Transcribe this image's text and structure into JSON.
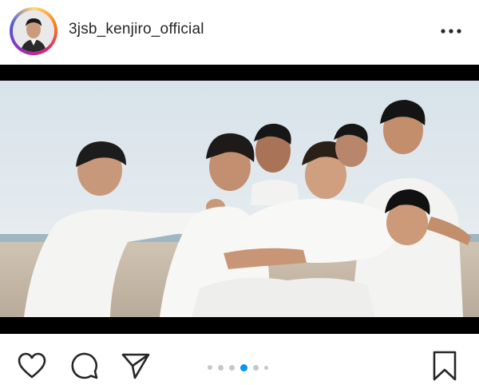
{
  "post": {
    "username": "3jsb_kenjiro_official"
  },
  "icons": {
    "more": "more-horizontal-icon",
    "like": "heart-icon",
    "comment": "comment-icon",
    "share": "share-icon",
    "save": "bookmark-icon"
  },
  "carousel": {
    "total": 6,
    "active_index": 3
  },
  "colors": {
    "active_dot": "#0095f6",
    "inactive_dot": "#c7c7c7",
    "text": "#262626"
  }
}
